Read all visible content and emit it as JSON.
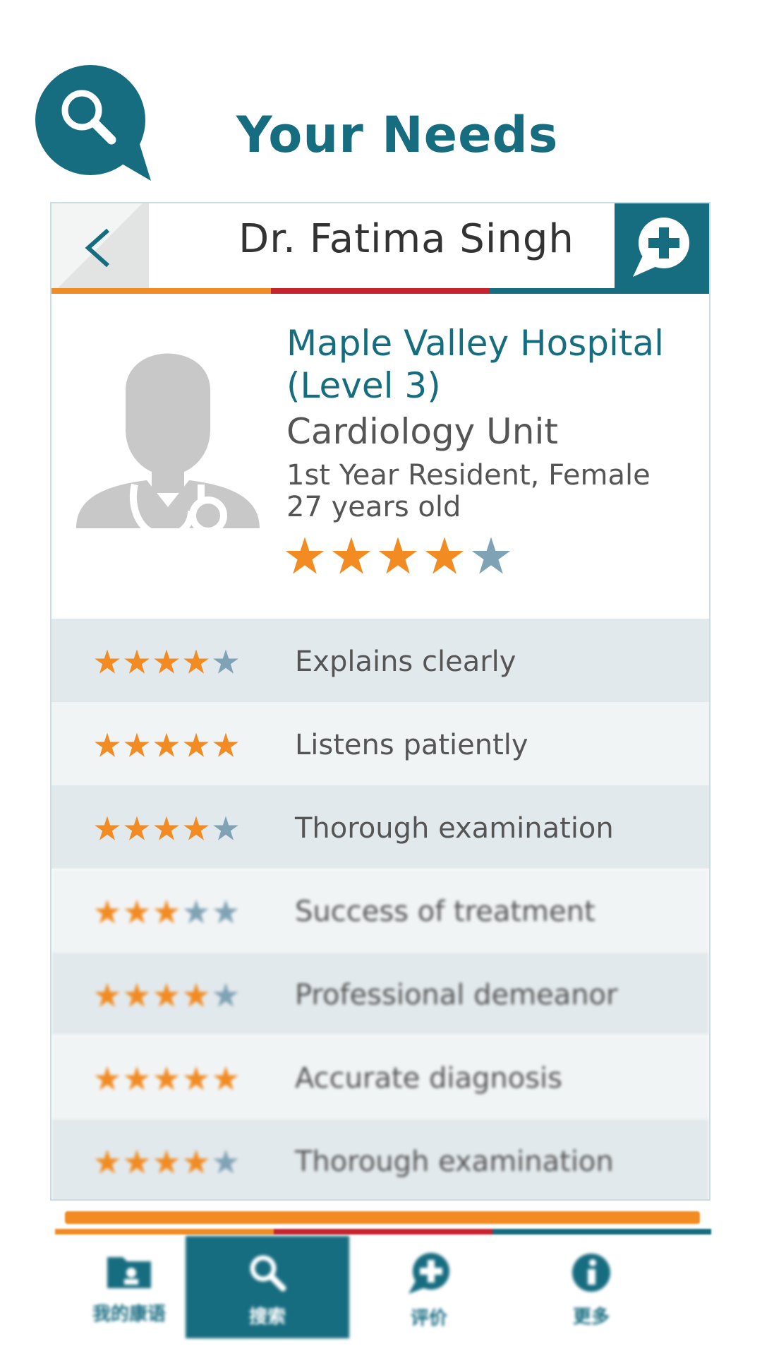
{
  "promo": {
    "heading": "Your Needs",
    "icon": "search-bubble-icon"
  },
  "colors": {
    "teal": "#176d80",
    "orange": "#f18b22",
    "red": "#c8222e",
    "star_filled": "#f18b22",
    "star_empty": "#7fa3b5"
  },
  "header": {
    "back_icon": "chevron-left-icon",
    "title": "Dr. Fatima Singh",
    "add_review_icon": "add-comment-icon"
  },
  "profile": {
    "avatar_icon": "doctor-avatar-icon",
    "hospital": "Maple Valley Hospital (Level 3)",
    "department": "Cardiology Unit",
    "title_line": "1st Year Resident, Female",
    "age_line": "27 years old",
    "overall_rating": 4,
    "rating_max": 5
  },
  "ratings": [
    {
      "label": "Explains clearly",
      "stars": 4
    },
    {
      "label": "Listens patiently",
      "stars": 5
    },
    {
      "label": "Thorough examination",
      "stars": 4
    },
    {
      "label": "Success of treatment",
      "stars": 3
    },
    {
      "label": "Professional demeanor",
      "stars": 4
    },
    {
      "label": "Accurate diagnosis",
      "stars": 5
    },
    {
      "label": "Thorough examination",
      "stars": 4
    }
  ],
  "bottom_nav": [
    {
      "label": "我的康语",
      "icon": "folder-profile-icon",
      "active": false
    },
    {
      "label": "搜索",
      "icon": "search-icon",
      "active": true
    },
    {
      "label": "评价",
      "icon": "add-comment-icon",
      "active": false
    },
    {
      "label": "更多",
      "icon": "info-icon",
      "active": false
    }
  ]
}
